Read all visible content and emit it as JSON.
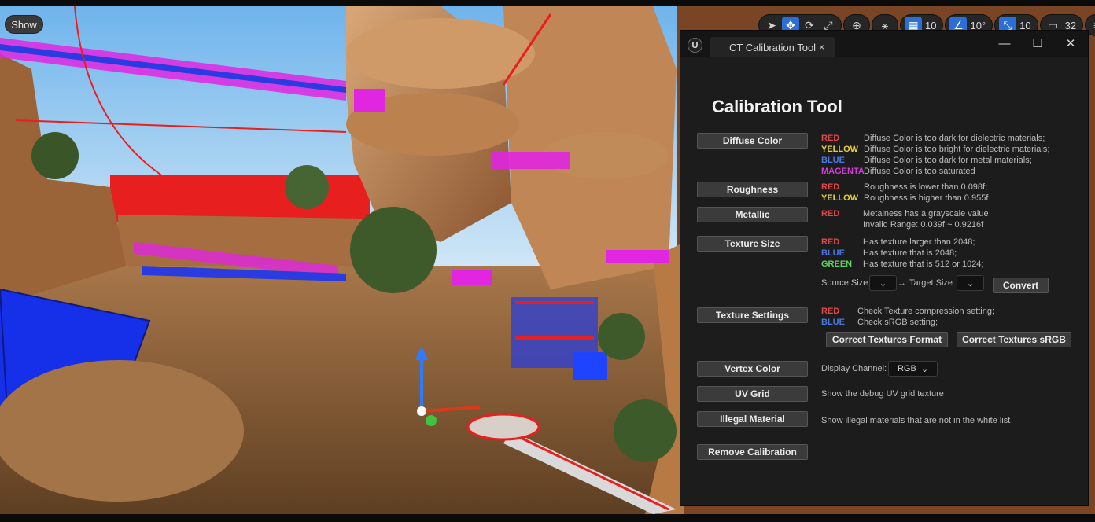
{
  "viewport": {
    "show_label": "Show",
    "toolbar": {
      "grid_snap": "10",
      "rotate_snap": "10°",
      "scale_snap": "10",
      "camera_speed": "32"
    }
  },
  "window": {
    "tab_title": "CT Calibration Tool",
    "tab_close": "×",
    "minimize": "—",
    "maximize": "☐",
    "close": "✕",
    "logo": "U",
    "panel_title": "Calibration Tool",
    "colors": {
      "red": "#e04848",
      "yellow": "#e8d23a",
      "blue": "#4a78e0",
      "magenta": "#d43bd4",
      "green": "#5fd35f"
    },
    "diffuse": {
      "button": "Diffuse Color",
      "rows": [
        {
          "tag": "RED",
          "text": "Diffuse Color is too dark for dielectric materials;"
        },
        {
          "tag": "YELLOW",
          "text": "Diffuse Color is too bright for dielectric materials;"
        },
        {
          "tag": "BLUE",
          "text": "Diffuse Color is too dark for metal materials;"
        },
        {
          "tag": "MAGENTA",
          "text": "Diffuse Color is too saturated"
        }
      ]
    },
    "roughness": {
      "button": "Roughness",
      "rows": [
        {
          "tag": "RED",
          "text": "Roughness is lower than 0.098f;"
        },
        {
          "tag": "YELLOW",
          "text": "Roughness is higher than 0.955f"
        }
      ]
    },
    "metallic": {
      "button": "Metallic",
      "rows": [
        {
          "tag": "RED",
          "text": "Metalness has a grayscale value"
        },
        {
          "tag": "",
          "text": "Invalid Range: 0.039f ~ 0.9216f"
        }
      ]
    },
    "texture_size": {
      "button": "Texture Size",
      "rows": [
        {
          "tag": "RED",
          "text": "Has texture larger than 2048;"
        },
        {
          "tag": "BLUE",
          "text": "Has texture that is 2048;"
        },
        {
          "tag": "GREEN",
          "text": "Has texture that is 512 or 1024;"
        }
      ],
      "source_size_label": "Source Size",
      "arrow": "→",
      "target_size_label": "Target Size",
      "convert_button": "Convert"
    },
    "texture_settings": {
      "button": "Texture Settings",
      "rows": [
        {
          "tag": "RED",
          "text": "Check Texture compression setting;"
        },
        {
          "tag": "BLUE",
          "text": "Check sRGB setting;"
        }
      ],
      "correct_format_button": "Correct Textures Format",
      "correct_srgb_button": "Correct Textures sRGB"
    },
    "vertex_color": {
      "button": "Vertex Color",
      "channel_label": "Display Channel:",
      "channel_value": "RGB"
    },
    "uv_grid": {
      "button": "UV Grid",
      "text": "Show the debug UV grid texture"
    },
    "illegal_material": {
      "button": "Illegal Material",
      "text": "Show illegal materials that are not in the white list"
    },
    "remove": {
      "button": "Remove Calibration"
    }
  }
}
